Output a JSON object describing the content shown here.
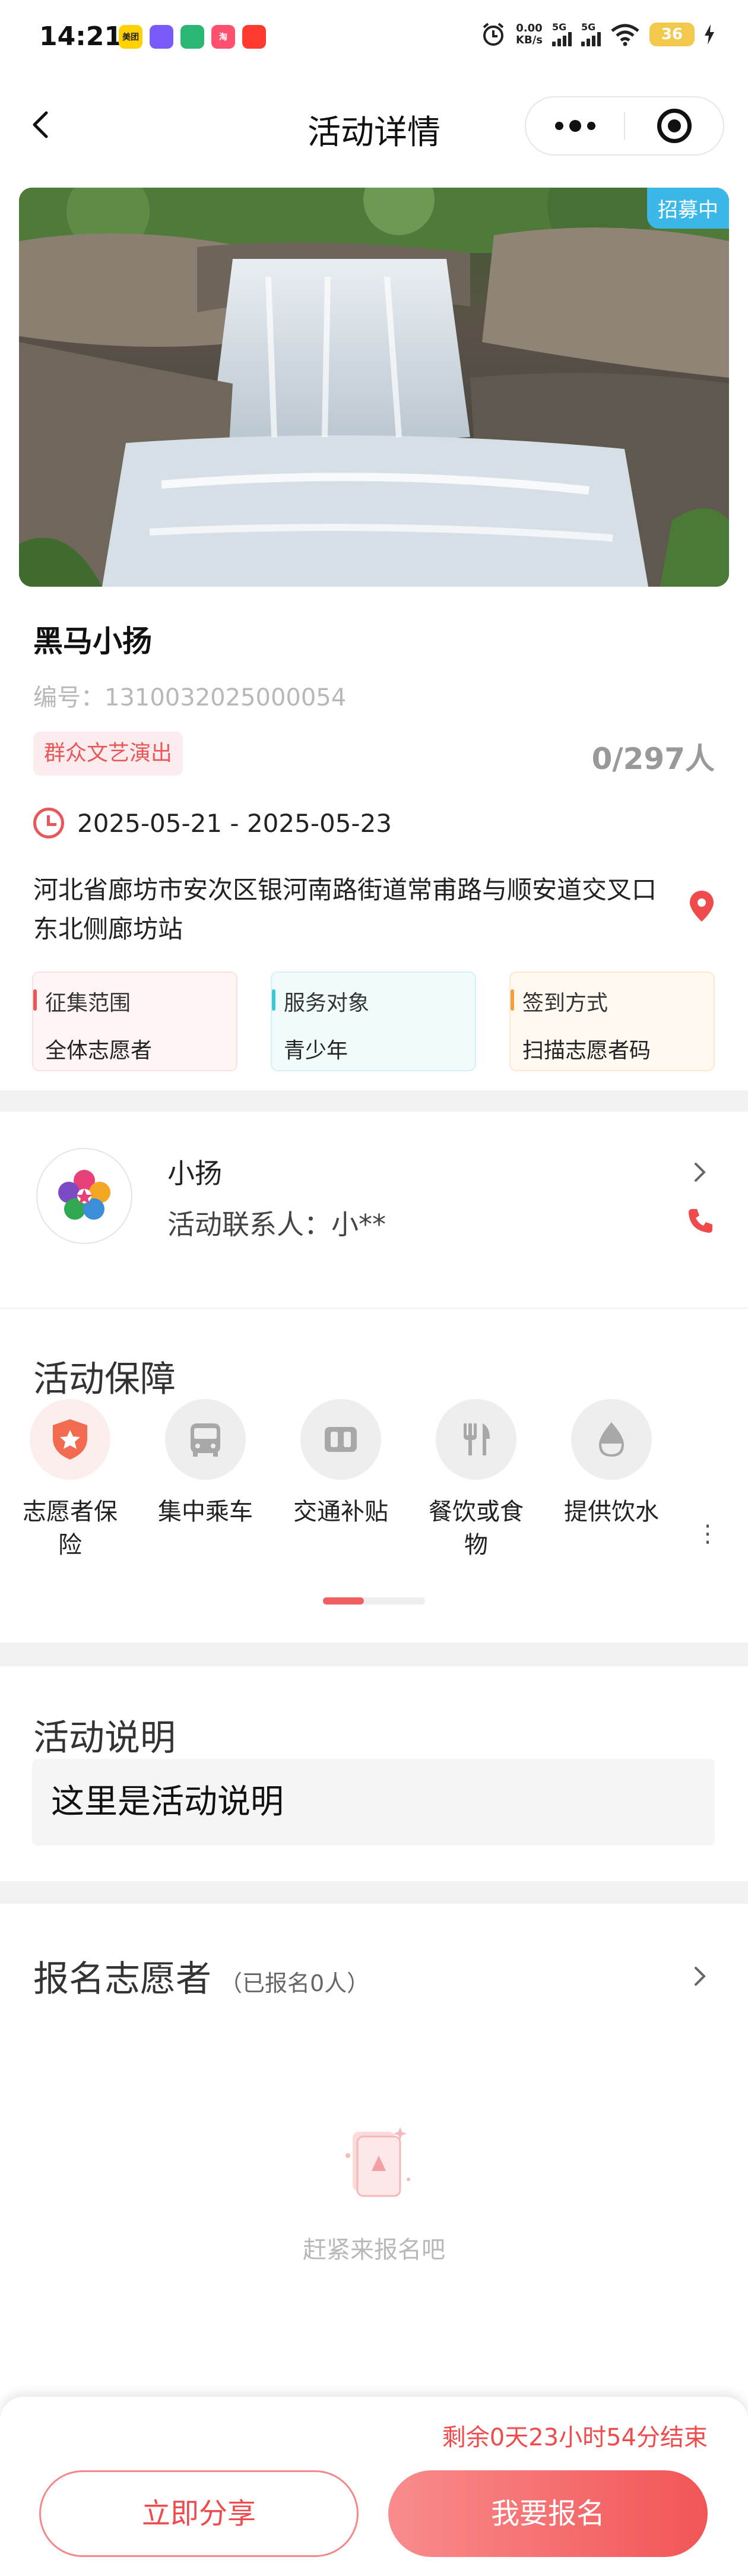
{
  "status_bar": {
    "time": "14:21",
    "net_speed": "0.00",
    "net_unit": "KB/s",
    "signal_1": "5G",
    "signal_2": "5G",
    "battery": "36",
    "app_badges": [
      {
        "label": "美团",
        "color": "#ffd100"
      },
      {
        "label": "",
        "color": "#7a5af8"
      },
      {
        "label": "",
        "color": "#2bb673"
      },
      {
        "label": "淘",
        "color": "#ff5070"
      },
      {
        "label": "",
        "color": "#ff3b30"
      }
    ]
  },
  "nav": {
    "title": "活动详情"
  },
  "activity": {
    "badge": "招募中",
    "title": "黑马小扬",
    "code": "编号：1310032025000054",
    "tag": "群众文艺演出",
    "count": "0/297人",
    "date_range": "2025-05-21 - 2025-05-23",
    "address": "河北省廊坊市安次区银河南路街道常甫路与顺安道交叉口东北侧廊坊站",
    "info": [
      {
        "key": "征集范围",
        "value": "全体志愿者"
      },
      {
        "key": "服务对象",
        "value": "青少年"
      },
      {
        "key": "签到方式",
        "value": "扫描志愿者码"
      }
    ]
  },
  "organizer": {
    "name": "小扬",
    "contact": "活动联系人：小**"
  },
  "guarantee": {
    "title": "活动保障",
    "items": [
      {
        "label": "志愿者保险",
        "icon": "shield-star-icon"
      },
      {
        "label": "集中乘车",
        "icon": "bus-icon"
      },
      {
        "label": "交通补贴",
        "icon": "subsidy-icon"
      },
      {
        "label": "餐饮或食物",
        "icon": "fork-knife-icon"
      },
      {
        "label": "提供饮水",
        "icon": "water-drop-icon"
      }
    ],
    "more": "⋮",
    "scroll_fraction": 0.4
  },
  "description": {
    "title": "活动说明",
    "text": "这里是活动说明"
  },
  "volunteers": {
    "title": "报名志愿者",
    "sub": "（已报名0人）",
    "empty_text": "赶紧来报名吧"
  },
  "footer": {
    "countdown": "剩余0天23小时54分结束",
    "share_label": "立即分享",
    "join_label": "我要报名"
  },
  "colors": {
    "accent": "#ef4b4d",
    "badge_blue": "#3bb8e8"
  }
}
